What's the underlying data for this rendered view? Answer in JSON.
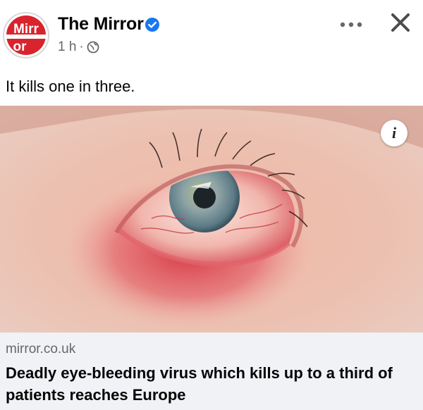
{
  "post": {
    "page_name": "The Mirror",
    "time": "1 h",
    "separator": "·",
    "caption": "It kills one in three.",
    "avatar_text_top": "Mirr",
    "avatar_text_bottom": "or",
    "more_icon": "more-dots-icon",
    "close_icon": "close-icon",
    "verified_icon": "verified-badge-icon",
    "privacy_icon": "globe-icon",
    "info_label": "i"
  },
  "link_preview": {
    "domain": "mirror.co.uk",
    "headline": "Deadly eye-bleeding virus which kills up to a third of patients reaches Europe"
  },
  "colors": {
    "brand_red": "#d9232d",
    "verified_blue": "#1877f2",
    "secondary_text": "#65676b",
    "link_bg": "#f0f2f5"
  }
}
